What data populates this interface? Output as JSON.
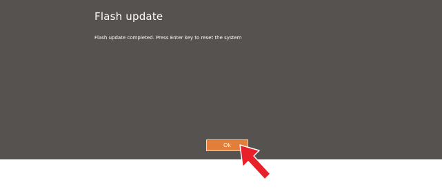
{
  "dialog": {
    "title": "Flash update",
    "message": "Flash update completed. Press Enter key to reset the system",
    "ok_label": "Ok"
  },
  "colors": {
    "dialog_background": "#56524f",
    "button_background": "#e07e3a",
    "button_border": "#f3dcc9",
    "pointer_arrow": "#e8202a"
  },
  "icons": {
    "pointer": "red-arrow-pointer-icon"
  }
}
